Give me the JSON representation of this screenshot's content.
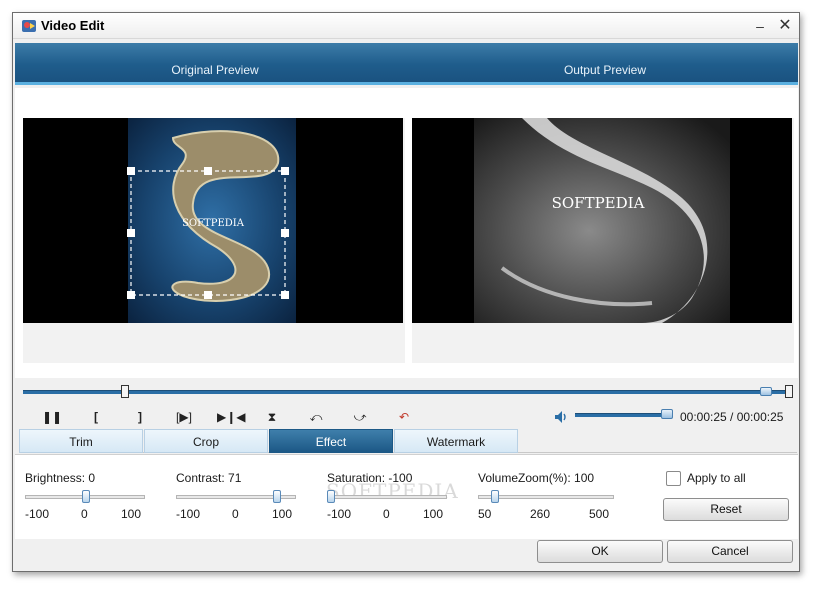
{
  "window": {
    "title": "Video Edit",
    "minimize_icon": "minimize-icon",
    "close_icon": "close-icon"
  },
  "preview": {
    "original_label": "Original Preview",
    "output_label": "Output Preview",
    "watermark_text": "SOFTPEDIA"
  },
  "playback": {
    "buttons": [
      "pause-icon",
      "set-start-icon",
      "set-end-icon",
      "play-segment-icon",
      "skip-icon",
      "flip-vertical-icon",
      "rotate-left-icon",
      "rotate-right-icon",
      "undo-icon"
    ],
    "volume_icon": "speaker-icon",
    "time": "00:00:25 / 00:00:25",
    "volume_level": 1.0
  },
  "tabs": [
    {
      "label": "Trim",
      "active": false
    },
    {
      "label": "Crop",
      "active": false
    },
    {
      "label": "Effect",
      "active": true
    },
    {
      "label": "Watermark",
      "active": false
    }
  ],
  "effect": {
    "brightness": {
      "label": "Brightness: 0",
      "value": 0,
      "min": -100,
      "max": 100,
      "ticks": [
        "-100",
        "0",
        "100"
      ]
    },
    "contrast": {
      "label": "Contrast: 71",
      "value": 71,
      "min": -100,
      "max": 100,
      "ticks": [
        "-100",
        "0",
        "100"
      ]
    },
    "saturation": {
      "label": "Saturation: -100",
      "value": -100,
      "min": -100,
      "max": 100,
      "ticks": [
        "-100",
        "0",
        "100"
      ]
    },
    "volume_zoom": {
      "label": "VolumeZoom(%): 100",
      "value": 100,
      "min": 50,
      "max": 500,
      "ticks": [
        "50",
        "260",
        "500"
      ]
    },
    "apply_to_all": "Apply to all",
    "reset": "Reset"
  },
  "background_watermark": "SOFTPEDIA",
  "footer": {
    "ok": "OK",
    "cancel": "Cancel"
  },
  "colors": {
    "header_blue": "#1f5d8c",
    "accent": "#2a6ea6",
    "active_tab": "#1c5886"
  }
}
